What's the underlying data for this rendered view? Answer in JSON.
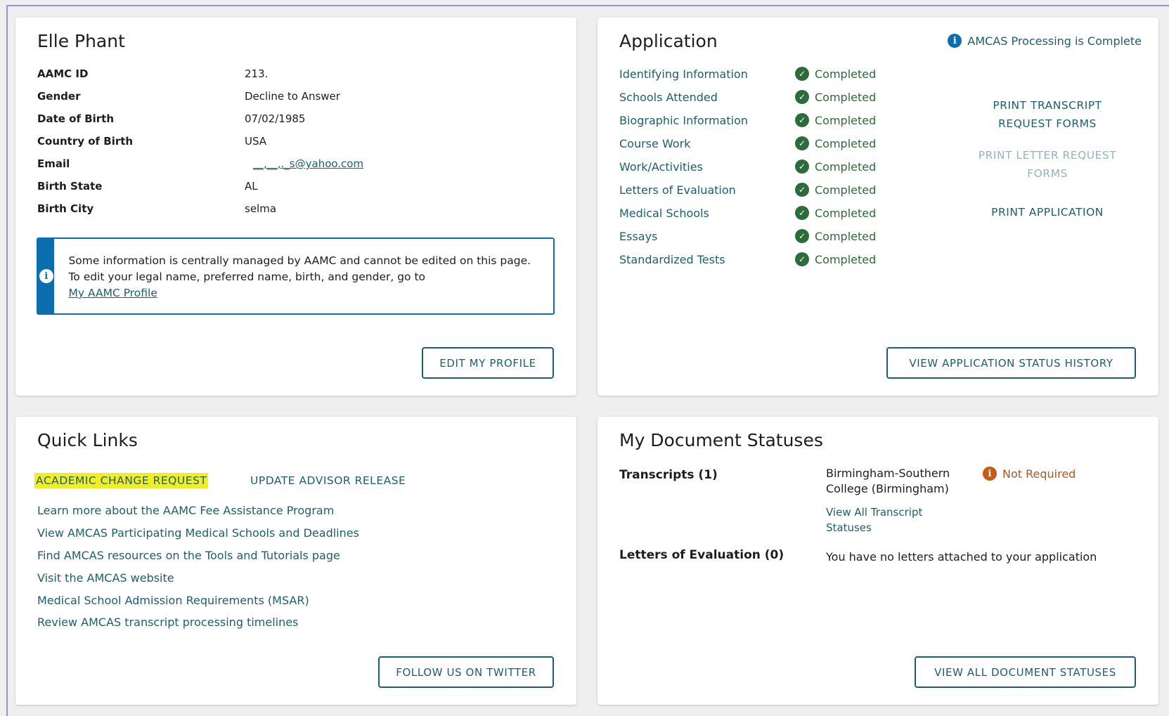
{
  "profile": {
    "name": "Elle Phant",
    "fields": [
      {
        "label": "AAMC ID",
        "value": "213."
      },
      {
        "label": "Gender",
        "value": "Decline to Answer"
      },
      {
        "label": "Date of Birth",
        "value": "07/02/1985"
      },
      {
        "label": "Country of Birth",
        "value": "USA"
      },
      {
        "label": "Email",
        "value": "__,__,._s@yahoo.com"
      },
      {
        "label": "Birth State",
        "value": "AL"
      },
      {
        "label": "Birth City",
        "value": "selma"
      }
    ],
    "notice_text": "Some information is centrally managed by AAMC and cannot be edited on this page. To edit your legal name, preferred name, birth, and gender, go to",
    "notice_link": "My AAMC Profile",
    "edit_button": "EDIT MY PROFILE"
  },
  "application": {
    "title": "Application",
    "processing_status": "AMCAS Processing is Complete",
    "sections": [
      {
        "name": "Identifying Information",
        "status": "Completed"
      },
      {
        "name": "Schools Attended",
        "status": "Completed"
      },
      {
        "name": "Biographic Information",
        "status": "Completed"
      },
      {
        "name": "Course Work",
        "status": "Completed"
      },
      {
        "name": "Work/Activities",
        "status": "Completed"
      },
      {
        "name": "Letters of Evaluation",
        "status": "Completed"
      },
      {
        "name": "Medical Schools",
        "status": "Completed"
      },
      {
        "name": "Essays",
        "status": "Completed"
      },
      {
        "name": "Standardized Tests",
        "status": "Completed"
      }
    ],
    "print_transcript": "PRINT TRANSCRIPT REQUEST FORMS",
    "print_letter": "PRINT LETTER REQUEST FORMS",
    "print_application": "PRINT APPLICATION",
    "history_button": "VIEW APPLICATION STATUS HISTORY"
  },
  "quick_links": {
    "title": "Quick Links",
    "academic_change": "ACADEMIC CHANGE REQUEST",
    "advisor_release": "UPDATE ADVISOR RELEASE",
    "items": [
      "Learn more about the AAMC Fee Assistance Program",
      "View AMCAS Participating Medical Schools and Deadlines",
      "Find AMCAS resources on the Tools and Tutorials page",
      "Visit the AMCAS website",
      "Medical School Admission Requirements (MSAR)",
      "Review AMCAS transcript processing timelines"
    ],
    "twitter_button": "FOLLOW US ON TWITTER"
  },
  "documents": {
    "title": "My Document Statuses",
    "transcripts_label": "Transcripts (1)",
    "school": "Birmingham-Southern College (Birmingham)",
    "transcript_status": "Not Required",
    "view_transcripts": "View All Transcript Statuses",
    "letters_label": "Letters of Evaluation (0)",
    "letters_text": "You have no letters attached to your application",
    "view_all_button": "VIEW ALL DOCUMENT STATUSES"
  },
  "colors": {
    "teal": "#1b5f6f",
    "success": "#2c6b3a",
    "info": "#0b6eaf",
    "warning": "#c55a19",
    "highlight": "#f2ee26"
  }
}
